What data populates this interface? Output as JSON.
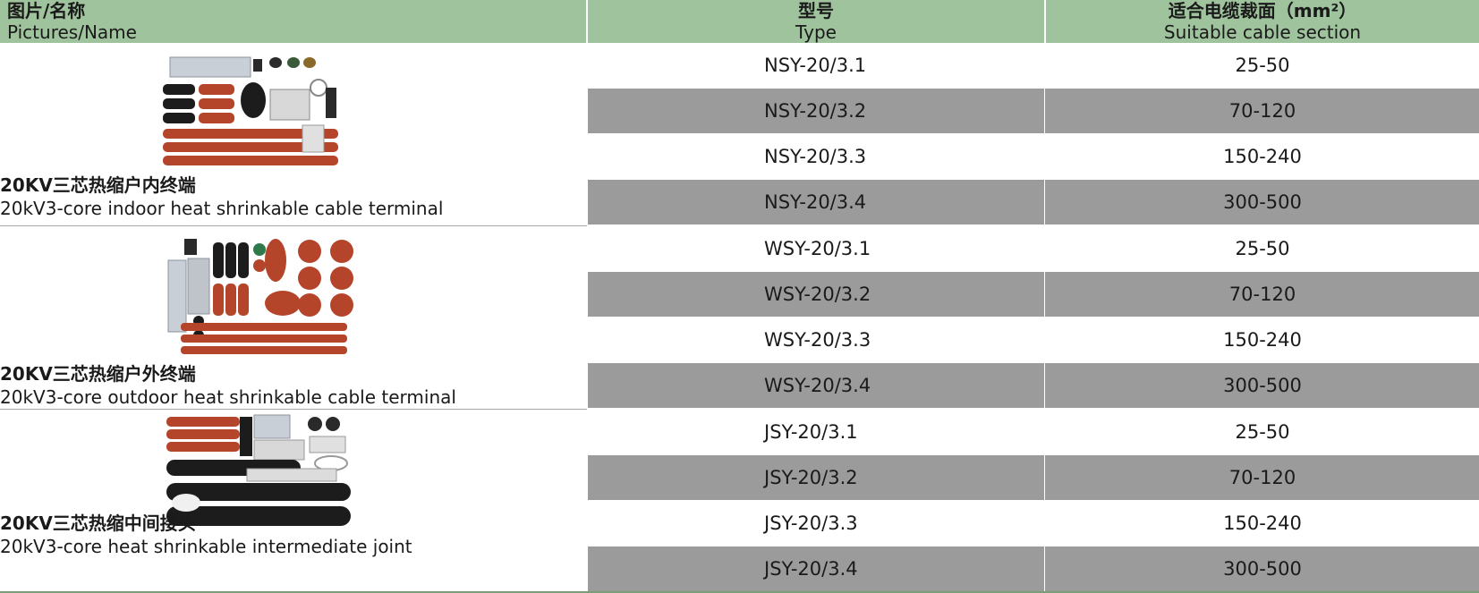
{
  "header": {
    "name_cn": "图片/名称",
    "name_en": "Pictures/Name",
    "type_cn": "型号",
    "type_en": "Type",
    "section_cn": "适合电缆裁面（mm²）",
    "section_en": "Suitable cable section"
  },
  "colors": {
    "header_bg": "#9fc39c",
    "row_gray": "#9b9b9b",
    "cable_red": "#b5452a",
    "cable_black": "#1c1c1c"
  },
  "groups": [
    {
      "name_cn": "20KV三芯热缩户内终端",
      "name_en": "20kV3-core indoor heat shrinkable cable terminal",
      "rows": [
        {
          "type": "NSY-20/3.1",
          "section": "25-50"
        },
        {
          "type": "NSY-20/3.2",
          "section": "70-120"
        },
        {
          "type": "NSY-20/3.3",
          "section": "150-240"
        },
        {
          "type": "NSY-20/3.4",
          "section": "300-500"
        }
      ]
    },
    {
      "name_cn": "20KV三芯热缩户外终端",
      "name_en": "20kV3-core outdoor heat shrinkable cable terminal",
      "rows": [
        {
          "type": "WSY-20/3.1",
          "section": "25-50"
        },
        {
          "type": "WSY-20/3.2",
          "section": "70-120"
        },
        {
          "type": "WSY-20/3.3",
          "section": "150-240"
        },
        {
          "type": "WSY-20/3.4",
          "section": "300-500"
        }
      ]
    },
    {
      "name_cn": "20KV三芯热缩中间接头",
      "name_en": "20kV3-core heat shrinkable intermediate joint",
      "rows": [
        {
          "type": "JSY-20/3.1",
          "section": "25-50"
        },
        {
          "type": "JSY-20/3.2",
          "section": "70-120"
        },
        {
          "type": "JSY-20/3.3",
          "section": "150-240"
        },
        {
          "type": "JSY-20/3.4",
          "section": "300-500"
        }
      ]
    }
  ]
}
